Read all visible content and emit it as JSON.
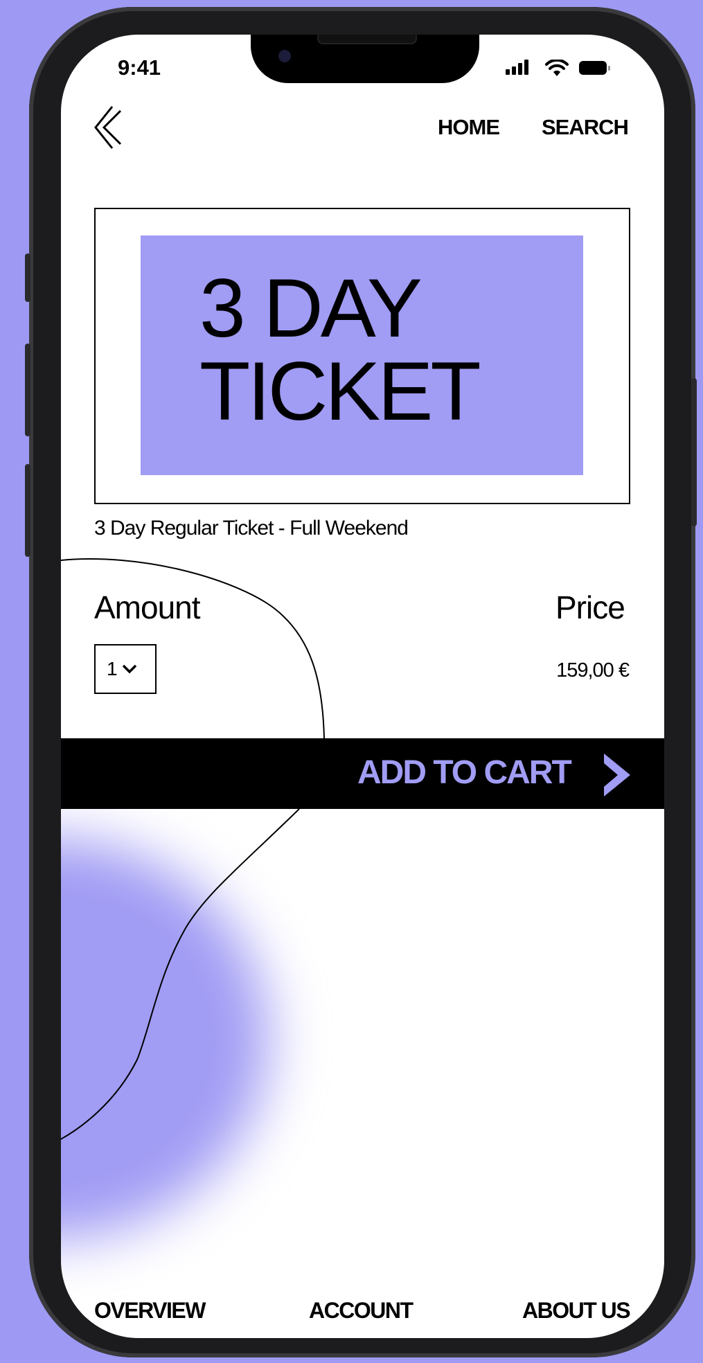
{
  "status_bar": {
    "time": "9:41"
  },
  "header": {
    "nav_links": [
      {
        "label": "HOME"
      },
      {
        "label": "SEARCH"
      }
    ]
  },
  "ticket": {
    "title_line1": "3 DAY",
    "title_line2": "TICKET",
    "caption": "3 Day Regular Ticket - Full Weekend"
  },
  "purchase": {
    "amount_label": "Amount",
    "price_label": "Price",
    "quantity": "1",
    "price": "159,00 €"
  },
  "cart": {
    "label": "ADD TO CART"
  },
  "bottom_nav": [
    {
      "label": "OVERVIEW"
    },
    {
      "label": "ACCOUNT"
    },
    {
      "label": "ABOUT US"
    }
  ],
  "colors": {
    "background": "#9e9af4",
    "accent": "#a19cf4",
    "screen": "#ffffff",
    "ink": "#000000"
  },
  "icons": [
    "back-chevron-icon",
    "cellular-signal-icon",
    "wifi-icon",
    "battery-icon",
    "chevron-down-icon",
    "chevron-right-icon"
  ]
}
